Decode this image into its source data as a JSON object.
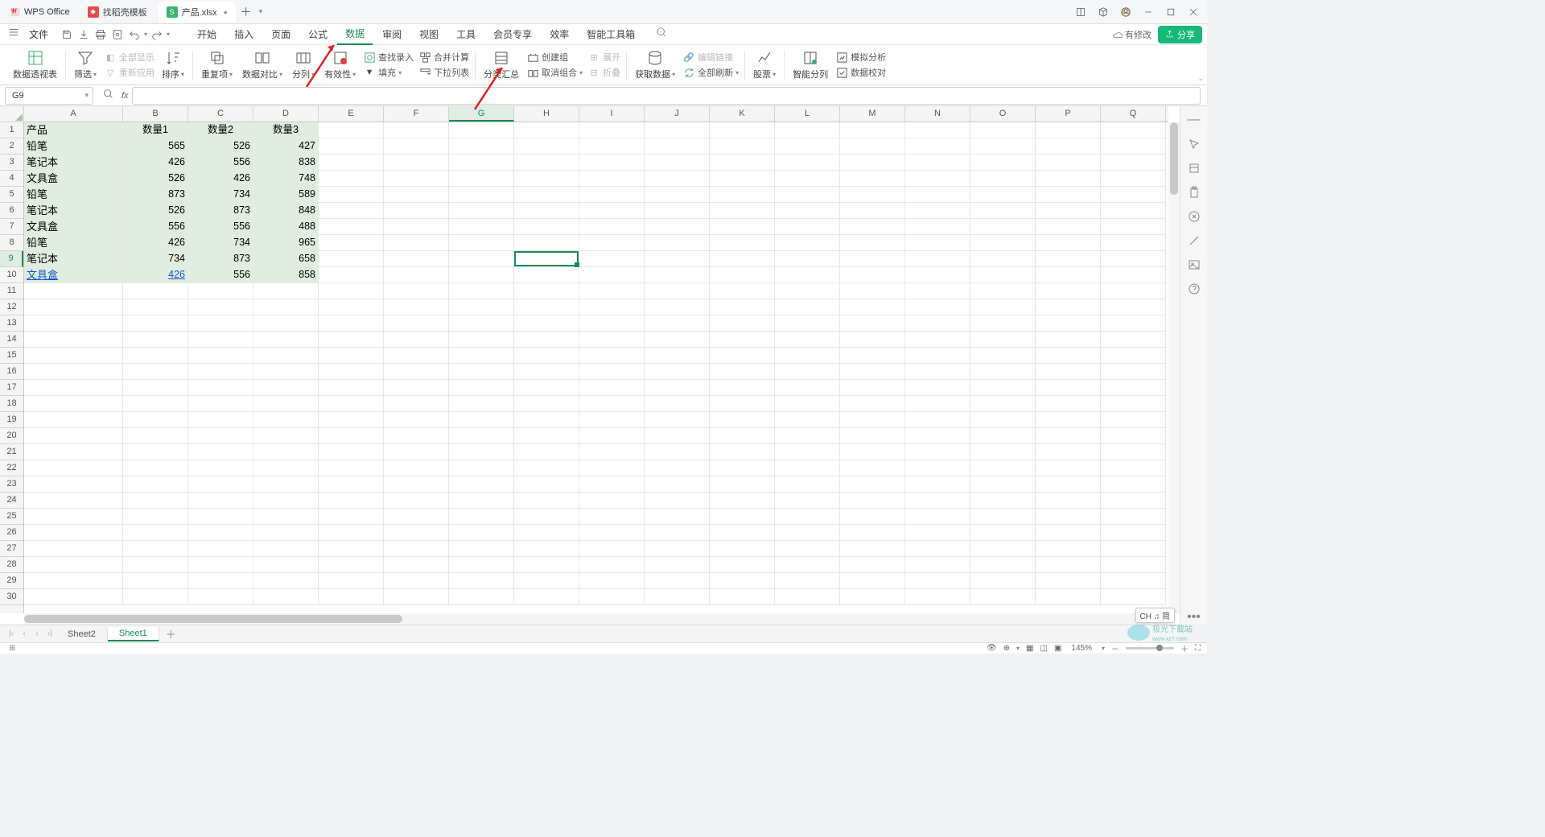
{
  "app": {
    "name": "WPS Office"
  },
  "tabs": {
    "template": "找稻壳模板",
    "file": "产品.xlsx"
  },
  "title_controls": {
    "has_changes": "有修改",
    "share": "分享"
  },
  "menu": {
    "file": "文件",
    "items": [
      "开始",
      "插入",
      "页面",
      "公式",
      "数据",
      "审阅",
      "视图",
      "工具",
      "会员专享",
      "效率",
      "智能工具箱"
    ],
    "active_index": 4
  },
  "ribbon": {
    "pivot": "数据透视表",
    "filter": "筛选",
    "show_all": "全部显示",
    "reapply": "重新应用",
    "sort": "排序",
    "dup": "重复项",
    "compare": "数据对比",
    "split": "分列",
    "validity": "有效性",
    "fill": "填充",
    "find_input": "查找录入",
    "merge_calc": "合并计算",
    "dropdown_list": "下拉列表",
    "subtotal": "分类汇总",
    "create_group": "创建组",
    "ungroup": "取消组合",
    "expand": "展开",
    "collapse": "折叠",
    "get_data": "获取数据",
    "edit_link": "编辑链接",
    "refresh_all": "全部刷新",
    "stock": "股票",
    "smart_split": "智能分列",
    "sim_analysis": "模拟分析",
    "data_valid": "数据校对"
  },
  "formula_bar": {
    "name_box": "G9",
    "fx": "fx"
  },
  "columns": [
    "A",
    "B",
    "C",
    "D",
    "E",
    "F",
    "G",
    "H",
    "I",
    "J",
    "K",
    "L",
    "M",
    "N",
    "O",
    "P",
    "Q"
  ],
  "rows_visible": 30,
  "active_cell": {
    "col": "G",
    "row": 9
  },
  "data_header": {
    "A": "产品",
    "B": "数量1",
    "C": "数量2",
    "D": "数量3"
  },
  "data_rows": [
    {
      "A": "铅笔",
      "B": 565,
      "C": 526,
      "D": 427
    },
    {
      "A": "笔记本",
      "B": 426,
      "C": 556,
      "D": 838
    },
    {
      "A": "文具盒",
      "B": 526,
      "C": 426,
      "D": 748
    },
    {
      "A": "铅笔",
      "B": 873,
      "C": 734,
      "D": 589
    },
    {
      "A": "笔记本",
      "B": 526,
      "C": 873,
      "D": 848
    },
    {
      "A": "文具盒",
      "B": 556,
      "C": 556,
      "D": 488
    },
    {
      "A": "铅笔",
      "B": 426,
      "C": 734,
      "D": 965
    },
    {
      "A": "笔记本",
      "B": 734,
      "C": 873,
      "D": 658
    },
    {
      "A": "文具盒",
      "B": 426,
      "C": 556,
      "D": 858
    }
  ],
  "data_last_link": true,
  "sheets": {
    "items": [
      "Sheet2",
      "Sheet1"
    ],
    "active": 1
  },
  "status": {
    "zoom": "145%",
    "ime": "CH ♫ 简"
  },
  "watermark": {
    "site": "www.xz7.com",
    "name": "极光下载站"
  }
}
